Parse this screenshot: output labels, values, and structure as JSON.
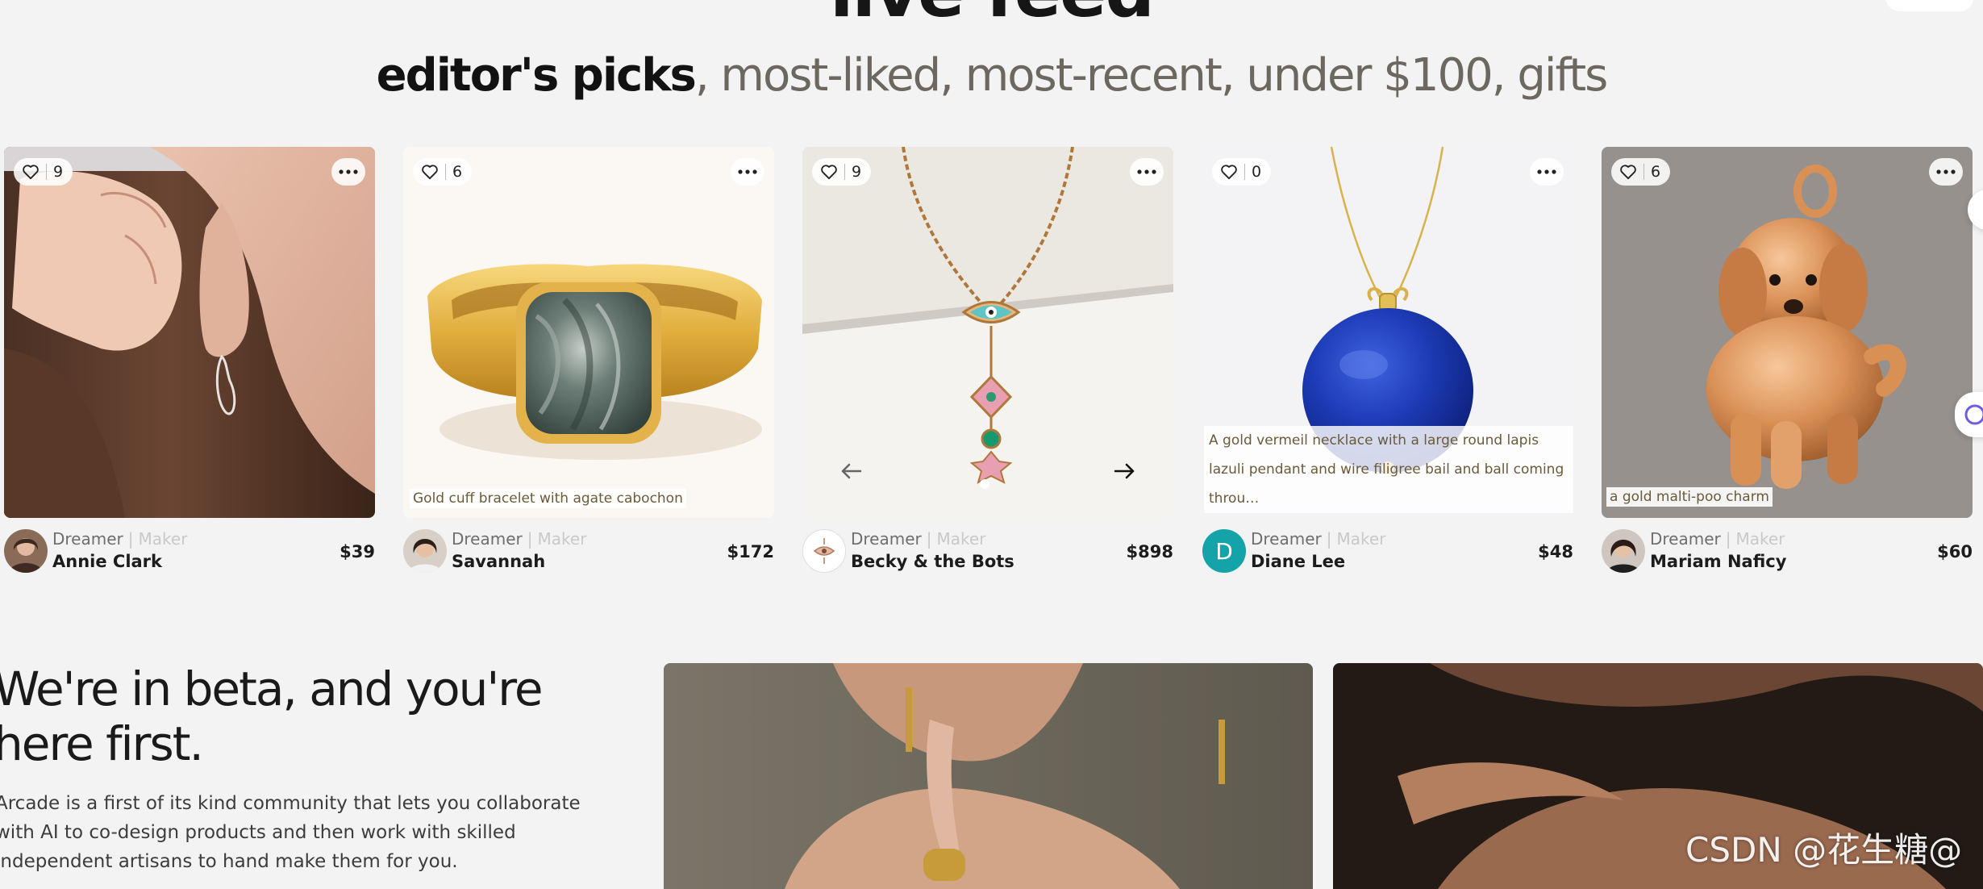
{
  "feed_title": "live feed",
  "filters": {
    "active": "editor's picks",
    "options": ", most-liked, most-recent, under $100, gifts"
  },
  "role_labels": {
    "dreamer": "Dreamer",
    "separator": "|",
    "maker": "Maker"
  },
  "cards": [
    {
      "likes": "9",
      "caption": "",
      "maker_name": "Annie Clark",
      "price": "$39",
      "avatar_letter": ""
    },
    {
      "likes": "6",
      "caption": "Gold cuff bracelet with agate cabochon",
      "maker_name": "Savannah",
      "price": "$172",
      "avatar_letter": ""
    },
    {
      "likes": "9",
      "caption": "",
      "maker_name": "Becky & the Bots",
      "price": "$898",
      "avatar_letter": ""
    },
    {
      "likes": "0",
      "caption": "A gold vermeil necklace with a large round lapis lazuli pendant and wire filigree bail and ball coming throu…",
      "maker_name": "Diane Lee",
      "price": "$48",
      "avatar_letter": "D"
    },
    {
      "likes": "6",
      "caption": "a gold malti-poo charm",
      "maker_name": "Mariam Naficy",
      "price": "$60",
      "avatar_letter": ""
    }
  ],
  "beta": {
    "heading": "We're in beta, and you're here first.",
    "body": "Arcade is a first of its kind community that lets you collaborate with AI to co-design products and then work with skilled independent artisans to hand make them for you."
  },
  "watermark": "CSDN @花生糖@",
  "colors": {
    "background": "#f3f3f3",
    "inactive_filter": "#6c675f",
    "avatar_teal": "#13a3a8",
    "caption_text": "#6b5a3a"
  },
  "icons": [
    "heart-icon",
    "more-icon",
    "arrow-left-icon",
    "arrow-right-icon"
  ]
}
